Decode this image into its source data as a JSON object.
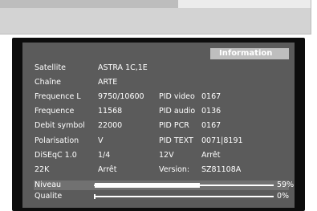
{
  "header": {
    "title": "Information"
  },
  "rows": [
    {
      "label": "Satellite",
      "value": "ASTRA 1C,1E",
      "label2": "",
      "value2": ""
    },
    {
      "label": "Chaîne",
      "value": "ARTE",
      "label2": "",
      "value2": ""
    },
    {
      "label": "Frequence L",
      "value": "9750/10600",
      "label2": "PID video",
      "value2": "0167"
    },
    {
      "label": "Frequence",
      "value": "11568",
      "label2": "PID audio",
      "value2": "0136"
    },
    {
      "label": "Debit symbol",
      "value": "22000",
      "label2": "PID PCR",
      "value2": "0167"
    },
    {
      "label": "Polarisation",
      "value": "V",
      "label2": "PID TEXT",
      "value2": "0071|8191"
    },
    {
      "label": "DiSEqC 1.0",
      "value": "1/4",
      "label2": "12V",
      "value2": "Arrêt"
    },
    {
      "label": "22K",
      "value": "Arrêt",
      "label2": "Version:",
      "value2": "SZ81108A"
    }
  ],
  "signal": {
    "niveau_label": "Niveau",
    "niveau_pct": "59%",
    "niveau_value": 0.59,
    "qualite_label": "Qualite",
    "qualite_pct": "0%",
    "qualite_value": 0
  },
  "colors": {
    "screen_bg": "#5b5b5b",
    "header_bg": "#bebebe",
    "text": "#ffffff"
  }
}
